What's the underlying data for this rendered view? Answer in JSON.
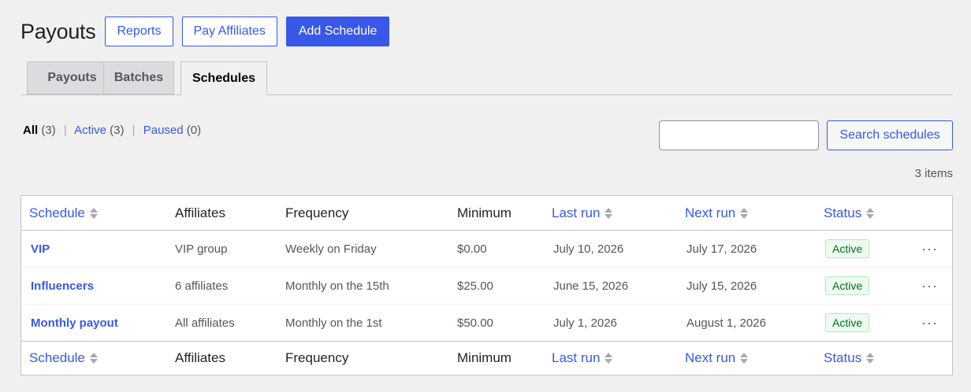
{
  "header": {
    "title": "Payouts",
    "reports_label": "Reports",
    "pay_affiliates_label": "Pay Affiliates",
    "add_schedule_label": "Add Schedule"
  },
  "tabs": [
    {
      "label": "Payouts",
      "active": false
    },
    {
      "label": "Batches",
      "active": false
    },
    {
      "label": "Schedules",
      "active": true
    }
  ],
  "filters": {
    "all": {
      "label": "All",
      "count": "(3)"
    },
    "active": {
      "label": "Active",
      "count": "(3)"
    },
    "paused": {
      "label": "Paused",
      "count": "(0)"
    },
    "separator": "|"
  },
  "search": {
    "value": "",
    "button_label": "Search schedules"
  },
  "item_count": "3 items",
  "table": {
    "columns": {
      "schedule": "Schedule",
      "affiliates": "Affiliates",
      "frequency": "Frequency",
      "minimum": "Minimum",
      "last_run": "Last run",
      "next_run": "Next run",
      "status": "Status"
    },
    "rows": [
      {
        "schedule": "VIP",
        "affiliates": "VIP group",
        "frequency": "Weekly on Friday",
        "minimum": "$0.00",
        "last_run": "July 10, 2026",
        "next_run": "July 17, 2026",
        "status": "Active"
      },
      {
        "schedule": "Influencers",
        "affiliates": "6 affiliates",
        "frequency": "Monthly on the 15th",
        "minimum": "$25.00",
        "last_run": "June 15, 2026",
        "next_run": "July 15, 2026",
        "status": "Active"
      },
      {
        "schedule": "Monthly payout",
        "affiliates": "All affiliates",
        "frequency": "Monthly on the 1st",
        "minimum": "$50.00",
        "last_run": "July 1, 2026",
        "next_run": "August 1, 2026",
        "status": "Active"
      }
    ],
    "row_actions_glyph": "···"
  },
  "colors": {
    "accent": "#3858e9",
    "active_badge": "#00701a",
    "background": "#f0f0f1"
  }
}
